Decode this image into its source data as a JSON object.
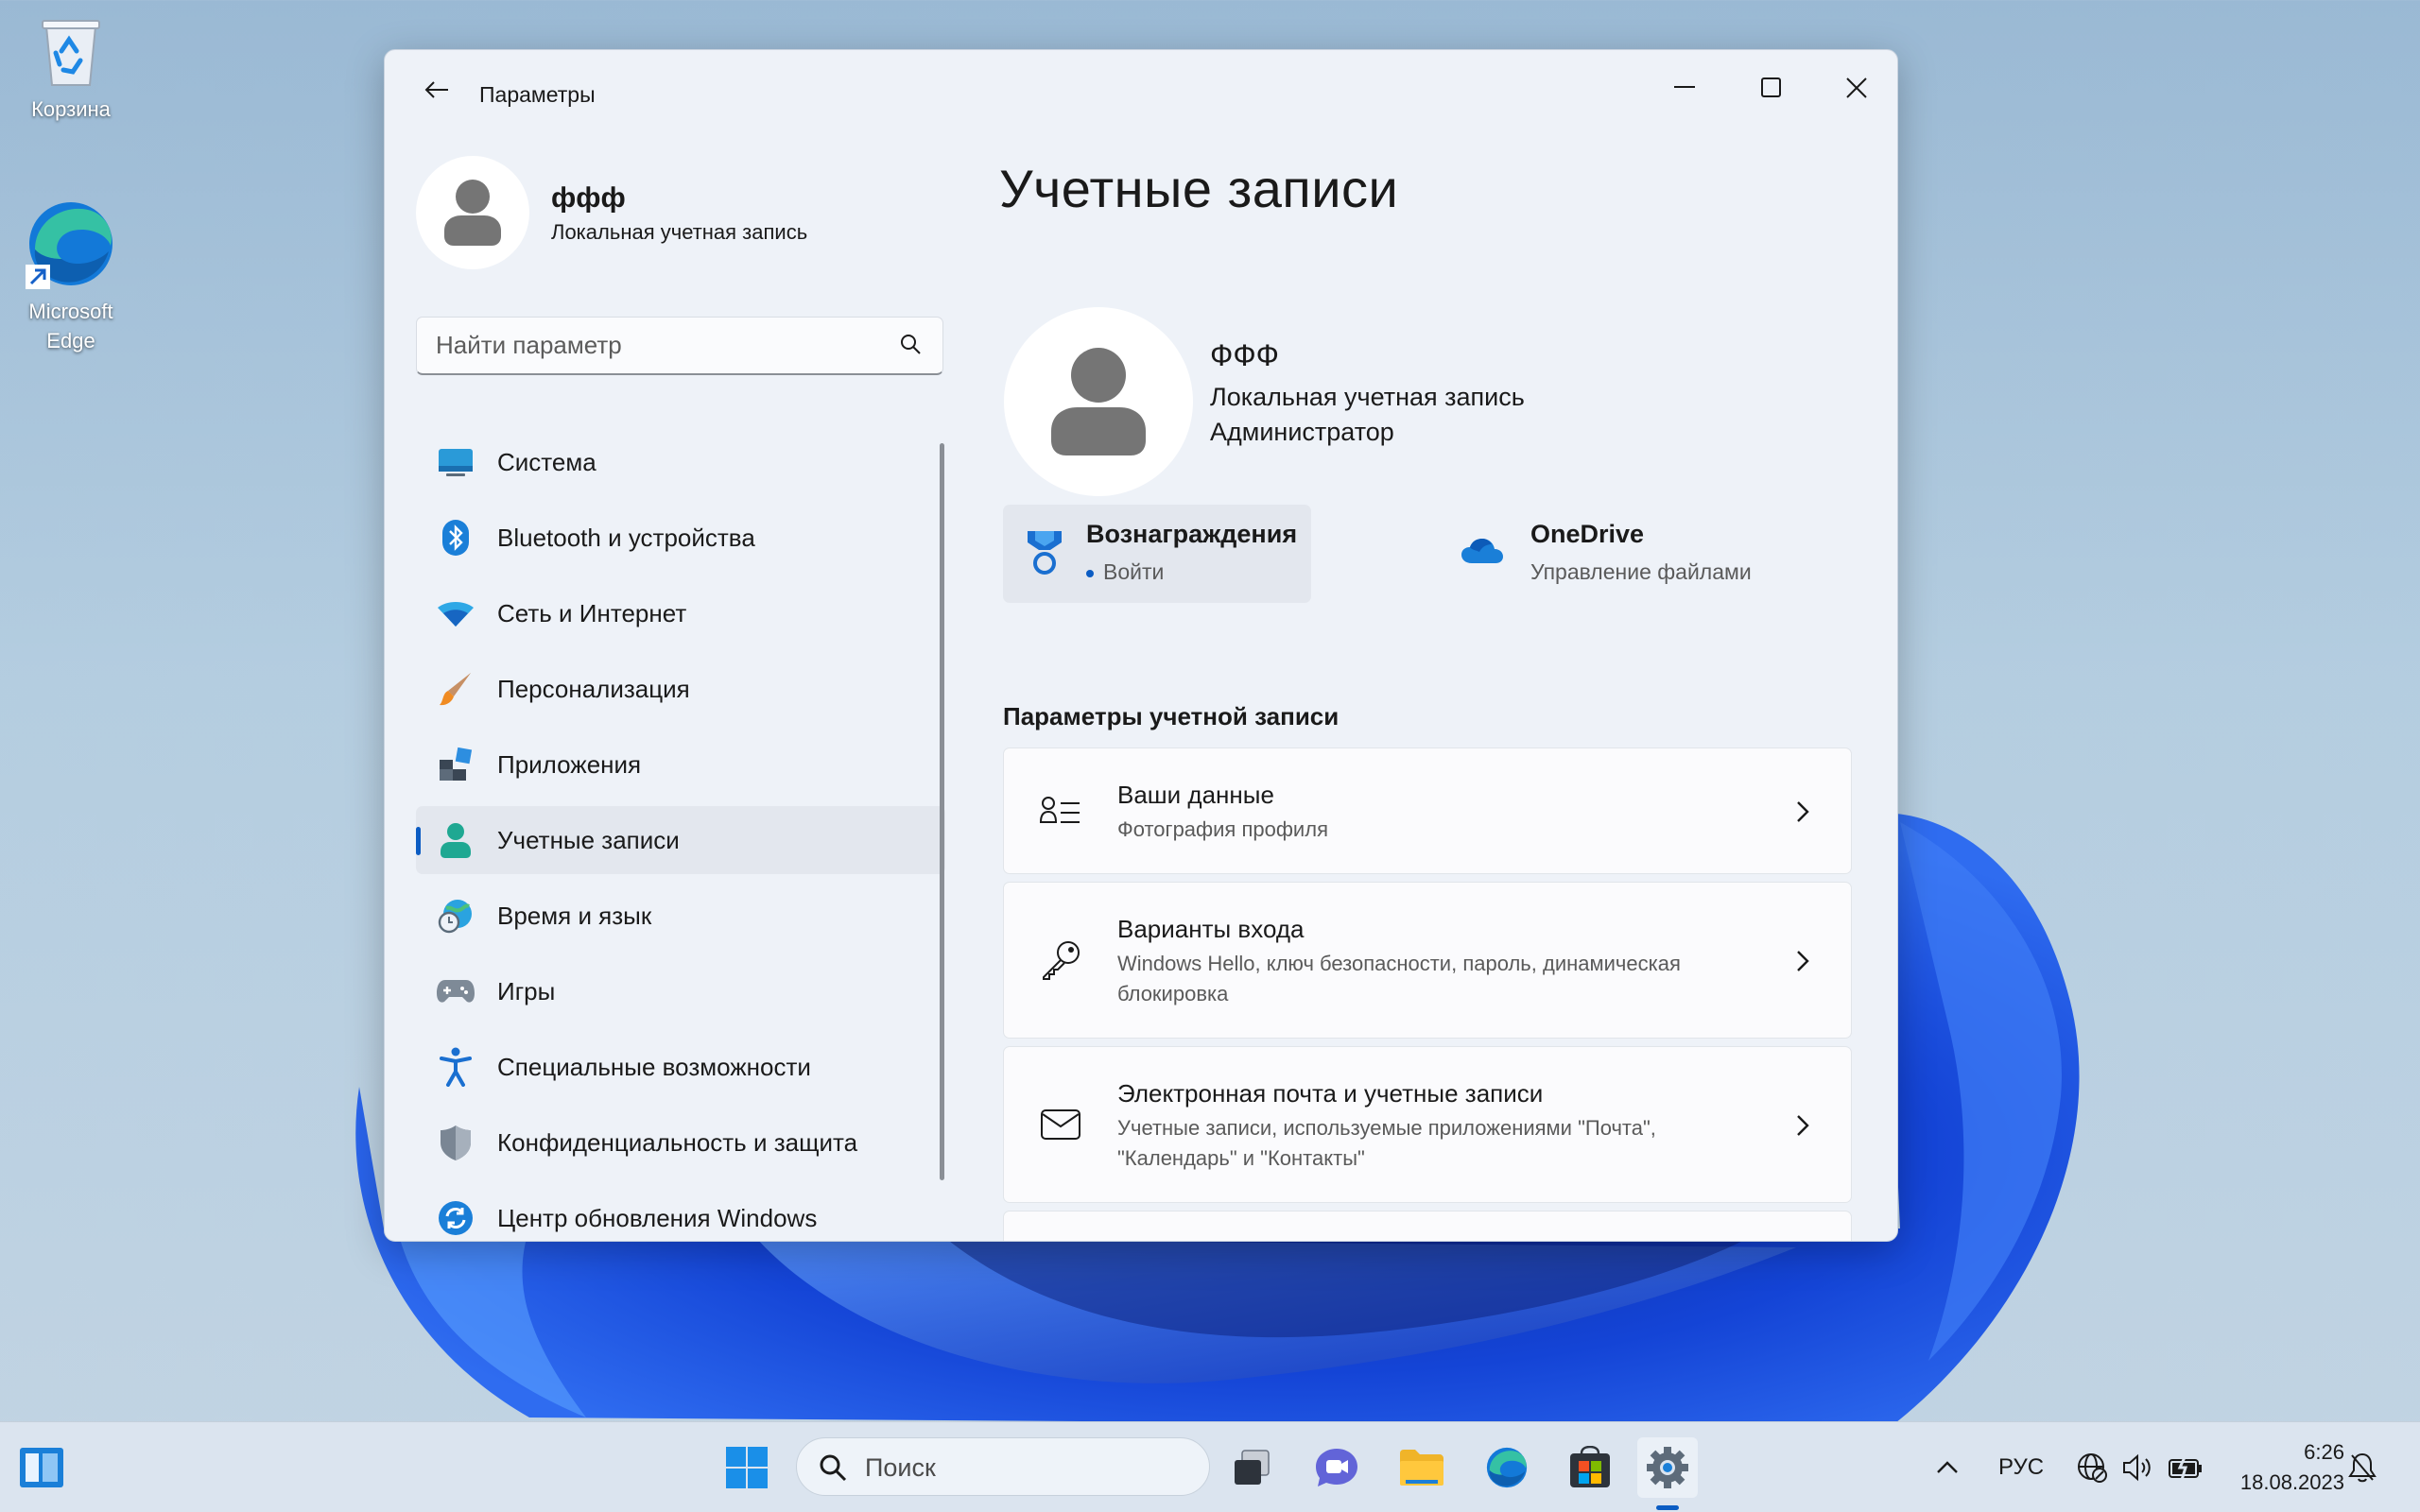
{
  "desktop": {
    "icons": [
      {
        "label": "Корзина"
      },
      {
        "label": "Microsoft Edge"
      }
    ]
  },
  "window": {
    "title": "Параметры",
    "profile": {
      "name": "ффф",
      "subtitle": "Локальная учетная запись"
    },
    "search": {
      "placeholder": "Найти параметр"
    },
    "nav": [
      {
        "label": "Система",
        "icon": "monitor-icon"
      },
      {
        "label": "Bluetooth и устройства",
        "icon": "bluetooth-icon"
      },
      {
        "label": "Сеть и Интернет",
        "icon": "wifi-icon"
      },
      {
        "label": "Персонализация",
        "icon": "brush-icon"
      },
      {
        "label": "Приложения",
        "icon": "apps-icon"
      },
      {
        "label": "Учетные записи",
        "icon": "person-icon",
        "active": true
      },
      {
        "label": "Время и язык",
        "icon": "globe-clock-icon"
      },
      {
        "label": "Игры",
        "icon": "gamepad-icon"
      },
      {
        "label": "Специальные возможности",
        "icon": "accessibility-icon"
      },
      {
        "label": "Конфиденциальность и защита",
        "icon": "shield-icon"
      },
      {
        "label": "Центр обновления Windows",
        "icon": "update-icon"
      }
    ],
    "content": {
      "heading": "Учетные записи",
      "user": {
        "name": "ФФФ",
        "type": "Локальная учетная запись",
        "role": "Администратор"
      },
      "rewards": {
        "title": "Вознаграждения",
        "status": "Войти"
      },
      "onedrive": {
        "title": "OneDrive",
        "subtitle": "Управление файлами"
      },
      "section_title": "Параметры учетной записи",
      "cards": [
        {
          "title": "Ваши данные",
          "subtitle": "Фотография профиля",
          "icon": "person-list-icon"
        },
        {
          "title": "Варианты входа",
          "subtitle": "Windows Hello, ключ безопасности, пароль, динамическая блокировка",
          "icon": "key-icon"
        },
        {
          "title": "Электронная почта и учетные записи",
          "subtitle": "Учетные записи, используемые приложениями \"Почта\", \"Календарь\" и \"Контакты\"",
          "icon": "mail-icon"
        }
      ]
    }
  },
  "taskbar": {
    "search_label": "Поиск",
    "language": "РУС",
    "time": "6:26",
    "date": "18.08.2023"
  },
  "colors": {
    "accent": "#0b5cc3",
    "window_bg": "#eef2f8",
    "card_bg": "#fbfbfd",
    "taskbar_bg": "#dbe4ef"
  }
}
